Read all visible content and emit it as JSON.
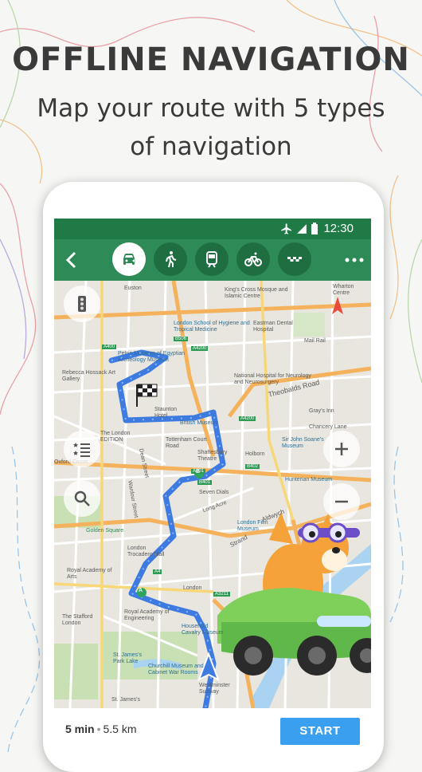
{
  "headline": "OFFLINE NAVIGATION",
  "subline": "Map your route with 5 types of navigation",
  "status": {
    "time": "12:30"
  },
  "appbar": {
    "modes": [
      {
        "name": "car",
        "active": true
      },
      {
        "name": "walk",
        "active": false
      },
      {
        "name": "public-transport",
        "active": false
      },
      {
        "name": "bicycle",
        "active": false
      },
      {
        "name": "taxi",
        "active": false
      }
    ]
  },
  "map": {
    "labels": {
      "euston": "Euston",
      "kings_cross": "King's Cross Mosque and Islamic Centre",
      "wharton": "Wharton Centre",
      "petrie": "Petrie Museum of Egyptian Archeology Museum",
      "london_school": "London School of Hygiene and Tropical Medicine",
      "eastman": "Eastman Dental Hospital",
      "mail_rail": "Mail Rail",
      "rebecca": "Rebecca Hossack Art Gallery",
      "national_hospital": "National Hospital for Neurology and Neurosurgery",
      "theobalds": "Theobalds Road",
      "british_museum": "British Museum",
      "staunton": "Staunton Hotel",
      "grays_inn": "Gray's Inn",
      "chancery": "Chancery Lane",
      "london_edition": "The London EDITION",
      "tottenham": "Tottenham Court Road",
      "shaftesbury": "Shaftesbury Theatre",
      "holborn": "Holborn",
      "sir_john": "Sir John Soane's Museum",
      "oxford": "Oxford Circus",
      "seven_dials": "Seven Dials",
      "hunterian": "Hunterian Museum",
      "long_acre": "Long Acre",
      "aldwych": "Aldwych",
      "golden": "Golden Square",
      "trocadero": "London Trocadero Mall",
      "film_museum": "London Film Museum",
      "royal_academy": "Royal Academy of Arts",
      "strand": "Strand",
      "wardour": "Wardour Street",
      "dean": "Dean Street",
      "london": "London",
      "stafford": "The Stafford London",
      "engineering": "Royal Academy of Engineering",
      "household": "Household Cavalry Museum",
      "churchill": "Churchill Museum and Cabinet War Rooms",
      "st_james_park": "St. James's Park Lake",
      "westminster": "Westminster Subway",
      "st_james": "St. James's",
      "a400": "A400",
      "a4200": "A4200",
      "b506": "B506",
      "b402": "B402",
      "b401": "B401",
      "a401": "A401",
      "a4": "A4",
      "a3211": "A3211"
    },
    "marker_a": "A",
    "marker_b": "B"
  },
  "summary": {
    "duration": "5 min",
    "distance": "5.5 km"
  },
  "start_label": "START",
  "colors": {
    "brand_green": "#2e8b57",
    "route_blue": "#3d7be0",
    "start_blue": "#3b9ff0"
  }
}
